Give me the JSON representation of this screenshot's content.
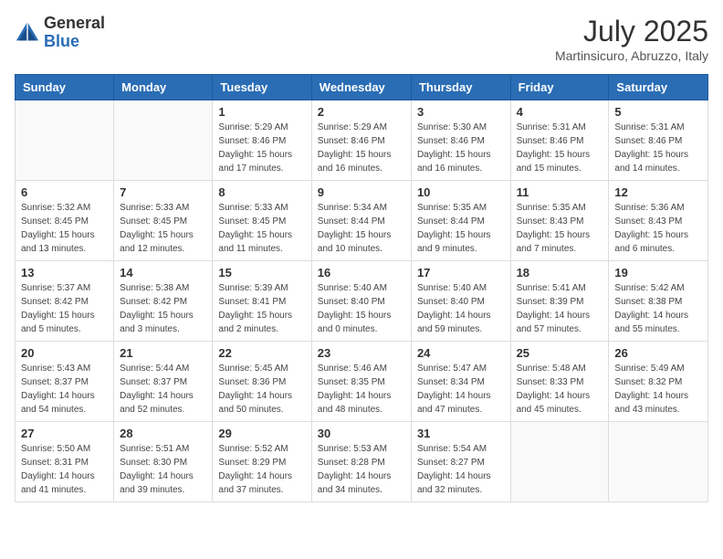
{
  "logo": {
    "general": "General",
    "blue": "Blue"
  },
  "title": {
    "month_year": "July 2025",
    "location": "Martinsicuro, Abruzzo, Italy"
  },
  "weekdays": [
    "Sunday",
    "Monday",
    "Tuesday",
    "Wednesday",
    "Thursday",
    "Friday",
    "Saturday"
  ],
  "weeks": [
    [
      {
        "day": "",
        "detail": ""
      },
      {
        "day": "",
        "detail": ""
      },
      {
        "day": "1",
        "detail": "Sunrise: 5:29 AM\nSunset: 8:46 PM\nDaylight: 15 hours\nand 17 minutes."
      },
      {
        "day": "2",
        "detail": "Sunrise: 5:29 AM\nSunset: 8:46 PM\nDaylight: 15 hours\nand 16 minutes."
      },
      {
        "day": "3",
        "detail": "Sunrise: 5:30 AM\nSunset: 8:46 PM\nDaylight: 15 hours\nand 16 minutes."
      },
      {
        "day": "4",
        "detail": "Sunrise: 5:31 AM\nSunset: 8:46 PM\nDaylight: 15 hours\nand 15 minutes."
      },
      {
        "day": "5",
        "detail": "Sunrise: 5:31 AM\nSunset: 8:46 PM\nDaylight: 15 hours\nand 14 minutes."
      }
    ],
    [
      {
        "day": "6",
        "detail": "Sunrise: 5:32 AM\nSunset: 8:45 PM\nDaylight: 15 hours\nand 13 minutes."
      },
      {
        "day": "7",
        "detail": "Sunrise: 5:33 AM\nSunset: 8:45 PM\nDaylight: 15 hours\nand 12 minutes."
      },
      {
        "day": "8",
        "detail": "Sunrise: 5:33 AM\nSunset: 8:45 PM\nDaylight: 15 hours\nand 11 minutes."
      },
      {
        "day": "9",
        "detail": "Sunrise: 5:34 AM\nSunset: 8:44 PM\nDaylight: 15 hours\nand 10 minutes."
      },
      {
        "day": "10",
        "detail": "Sunrise: 5:35 AM\nSunset: 8:44 PM\nDaylight: 15 hours\nand 9 minutes."
      },
      {
        "day": "11",
        "detail": "Sunrise: 5:35 AM\nSunset: 8:43 PM\nDaylight: 15 hours\nand 7 minutes."
      },
      {
        "day": "12",
        "detail": "Sunrise: 5:36 AM\nSunset: 8:43 PM\nDaylight: 15 hours\nand 6 minutes."
      }
    ],
    [
      {
        "day": "13",
        "detail": "Sunrise: 5:37 AM\nSunset: 8:42 PM\nDaylight: 15 hours\nand 5 minutes."
      },
      {
        "day": "14",
        "detail": "Sunrise: 5:38 AM\nSunset: 8:42 PM\nDaylight: 15 hours\nand 3 minutes."
      },
      {
        "day": "15",
        "detail": "Sunrise: 5:39 AM\nSunset: 8:41 PM\nDaylight: 15 hours\nand 2 minutes."
      },
      {
        "day": "16",
        "detail": "Sunrise: 5:40 AM\nSunset: 8:40 PM\nDaylight: 15 hours\nand 0 minutes."
      },
      {
        "day": "17",
        "detail": "Sunrise: 5:40 AM\nSunset: 8:40 PM\nDaylight: 14 hours\nand 59 minutes."
      },
      {
        "day": "18",
        "detail": "Sunrise: 5:41 AM\nSunset: 8:39 PM\nDaylight: 14 hours\nand 57 minutes."
      },
      {
        "day": "19",
        "detail": "Sunrise: 5:42 AM\nSunset: 8:38 PM\nDaylight: 14 hours\nand 55 minutes."
      }
    ],
    [
      {
        "day": "20",
        "detail": "Sunrise: 5:43 AM\nSunset: 8:37 PM\nDaylight: 14 hours\nand 54 minutes."
      },
      {
        "day": "21",
        "detail": "Sunrise: 5:44 AM\nSunset: 8:37 PM\nDaylight: 14 hours\nand 52 minutes."
      },
      {
        "day": "22",
        "detail": "Sunrise: 5:45 AM\nSunset: 8:36 PM\nDaylight: 14 hours\nand 50 minutes."
      },
      {
        "day": "23",
        "detail": "Sunrise: 5:46 AM\nSunset: 8:35 PM\nDaylight: 14 hours\nand 48 minutes."
      },
      {
        "day": "24",
        "detail": "Sunrise: 5:47 AM\nSunset: 8:34 PM\nDaylight: 14 hours\nand 47 minutes."
      },
      {
        "day": "25",
        "detail": "Sunrise: 5:48 AM\nSunset: 8:33 PM\nDaylight: 14 hours\nand 45 minutes."
      },
      {
        "day": "26",
        "detail": "Sunrise: 5:49 AM\nSunset: 8:32 PM\nDaylight: 14 hours\nand 43 minutes."
      }
    ],
    [
      {
        "day": "27",
        "detail": "Sunrise: 5:50 AM\nSunset: 8:31 PM\nDaylight: 14 hours\nand 41 minutes."
      },
      {
        "day": "28",
        "detail": "Sunrise: 5:51 AM\nSunset: 8:30 PM\nDaylight: 14 hours\nand 39 minutes."
      },
      {
        "day": "29",
        "detail": "Sunrise: 5:52 AM\nSunset: 8:29 PM\nDaylight: 14 hours\nand 37 minutes."
      },
      {
        "day": "30",
        "detail": "Sunrise: 5:53 AM\nSunset: 8:28 PM\nDaylight: 14 hours\nand 34 minutes."
      },
      {
        "day": "31",
        "detail": "Sunrise: 5:54 AM\nSunset: 8:27 PM\nDaylight: 14 hours\nand 32 minutes."
      },
      {
        "day": "",
        "detail": ""
      },
      {
        "day": "",
        "detail": ""
      }
    ]
  ]
}
